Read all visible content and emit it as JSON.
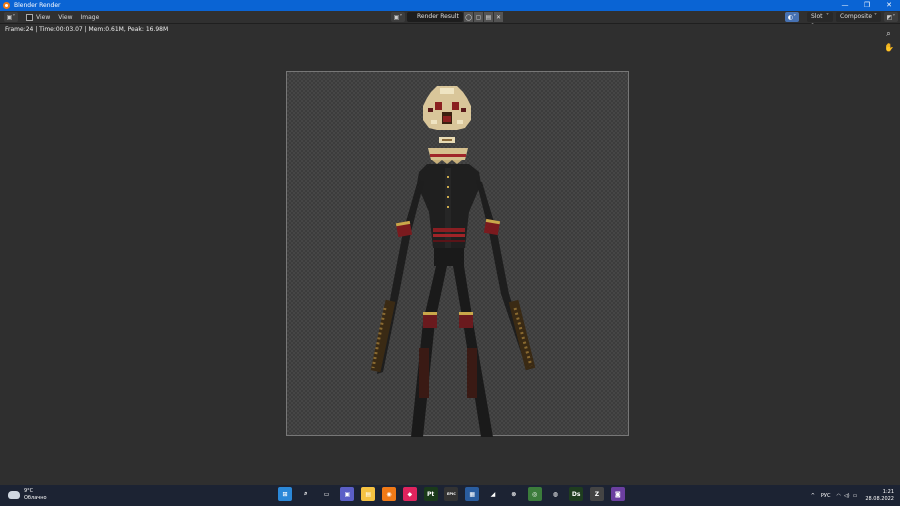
{
  "window": {
    "title": "Blender Render",
    "controls": {
      "minimize": "—",
      "maximize": "❐",
      "close": "✕"
    }
  },
  "header": {
    "editor_type_icon": "image-editor-icon",
    "menus": [
      "View",
      "View",
      "Image"
    ],
    "image_name": "Render Result",
    "slot": "Slot 1",
    "pass": "Composite"
  },
  "viewport": {
    "stats": "Frame:24 | Time:00:03.07 | Mem:0.61M, Peak: 16.98M",
    "tools": [
      "zoom-icon",
      "pan-hand-icon"
    ]
  },
  "taskbar": {
    "weather": {
      "temp": "9°C",
      "desc": "Облачно"
    },
    "apps": [
      {
        "name": "windows-start-icon",
        "color": "#2b88d8",
        "glyph": "⊞"
      },
      {
        "name": "search-icon",
        "color": "#1c2333",
        "glyph": "⌕"
      },
      {
        "name": "task-view-icon",
        "color": "#1c2333",
        "glyph": "▭"
      },
      {
        "name": "chat-icon",
        "color": "#5b5fc7",
        "glyph": "▣"
      },
      {
        "name": "file-explorer-icon",
        "color": "#f5c242",
        "glyph": "▤"
      },
      {
        "name": "blender-icon",
        "color": "#f07a17",
        "glyph": "◉"
      },
      {
        "name": "app-red-icon",
        "color": "#e0245e",
        "glyph": "◆"
      },
      {
        "name": "substance-painter-icon",
        "color": "#1a3a1a",
        "glyph": "Pt"
      },
      {
        "name": "epic-games-icon",
        "color": "#333",
        "glyph": "EPIC"
      },
      {
        "name": "image-viewer-icon",
        "color": "#2a5d9f",
        "glyph": "▦"
      },
      {
        "name": "nvidia-icon",
        "color": "#1c2333",
        "glyph": "◢"
      },
      {
        "name": "xbox-icon",
        "color": "#1c2333",
        "glyph": "⊗"
      },
      {
        "name": "chrome-icon",
        "color": "#3b7c3b",
        "glyph": "◎"
      },
      {
        "name": "steam-icon",
        "color": "#1c2333",
        "glyph": "◍"
      },
      {
        "name": "daz-studio-icon",
        "color": "#1f3d1f",
        "glyph": "Ds"
      },
      {
        "name": "zbrush-icon",
        "color": "#444",
        "glyph": "Z"
      },
      {
        "name": "app-purple-icon",
        "color": "#6b3fa0",
        "glyph": "◙"
      }
    ],
    "tray": {
      "chevron": "^",
      "lang": "РУС",
      "wifi": "wifi-icon",
      "volume": "volume-icon",
      "battery": "battery-icon"
    },
    "clock": {
      "time": "1:21",
      "date": "28.08.2022"
    }
  },
  "colors": {
    "titlebar": "#0a64d4",
    "header": "#303030",
    "viewport": "#2f2f2f",
    "taskbar": "#1c2333",
    "accent": "#4772b3"
  }
}
